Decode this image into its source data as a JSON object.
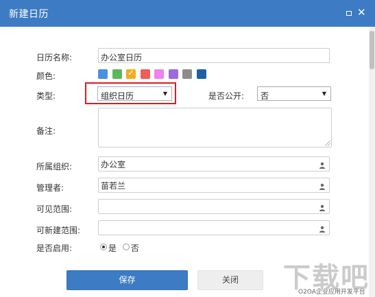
{
  "dialog": {
    "title": "新建日历"
  },
  "form": {
    "name_label": "日历名称:",
    "name_value": "办公室日历",
    "color_label": "颜色:",
    "colors": [
      "#4a90e2",
      "#5cb85c",
      "#f0ad1e",
      "#ef5d57",
      "#ee82ee",
      "#9c6ade",
      "#8c8c8c",
      "#1f5fa8"
    ],
    "selected_color_index": 2,
    "type_label": "类型:",
    "type_value": "组织日历",
    "public_label": "是否公开:",
    "public_value": "否",
    "remark_label": "备注:",
    "remark_value": "",
    "org_label": "所属组织:",
    "org_value": "办公室",
    "manager_label": "管理者:",
    "manager_value": "苗若兰",
    "visible_label": "可见范围:",
    "visible_value": "",
    "create_label": "可新建范围:",
    "create_value": "",
    "enabled_label": "是否启用:",
    "enabled_yes": "是",
    "enabled_no": "否",
    "enabled_selected": "是"
  },
  "buttons": {
    "save": "保存",
    "close": "关闭"
  },
  "watermark": {
    "big": "下载吧",
    "small": "O2OA企业应用开发平台"
  }
}
